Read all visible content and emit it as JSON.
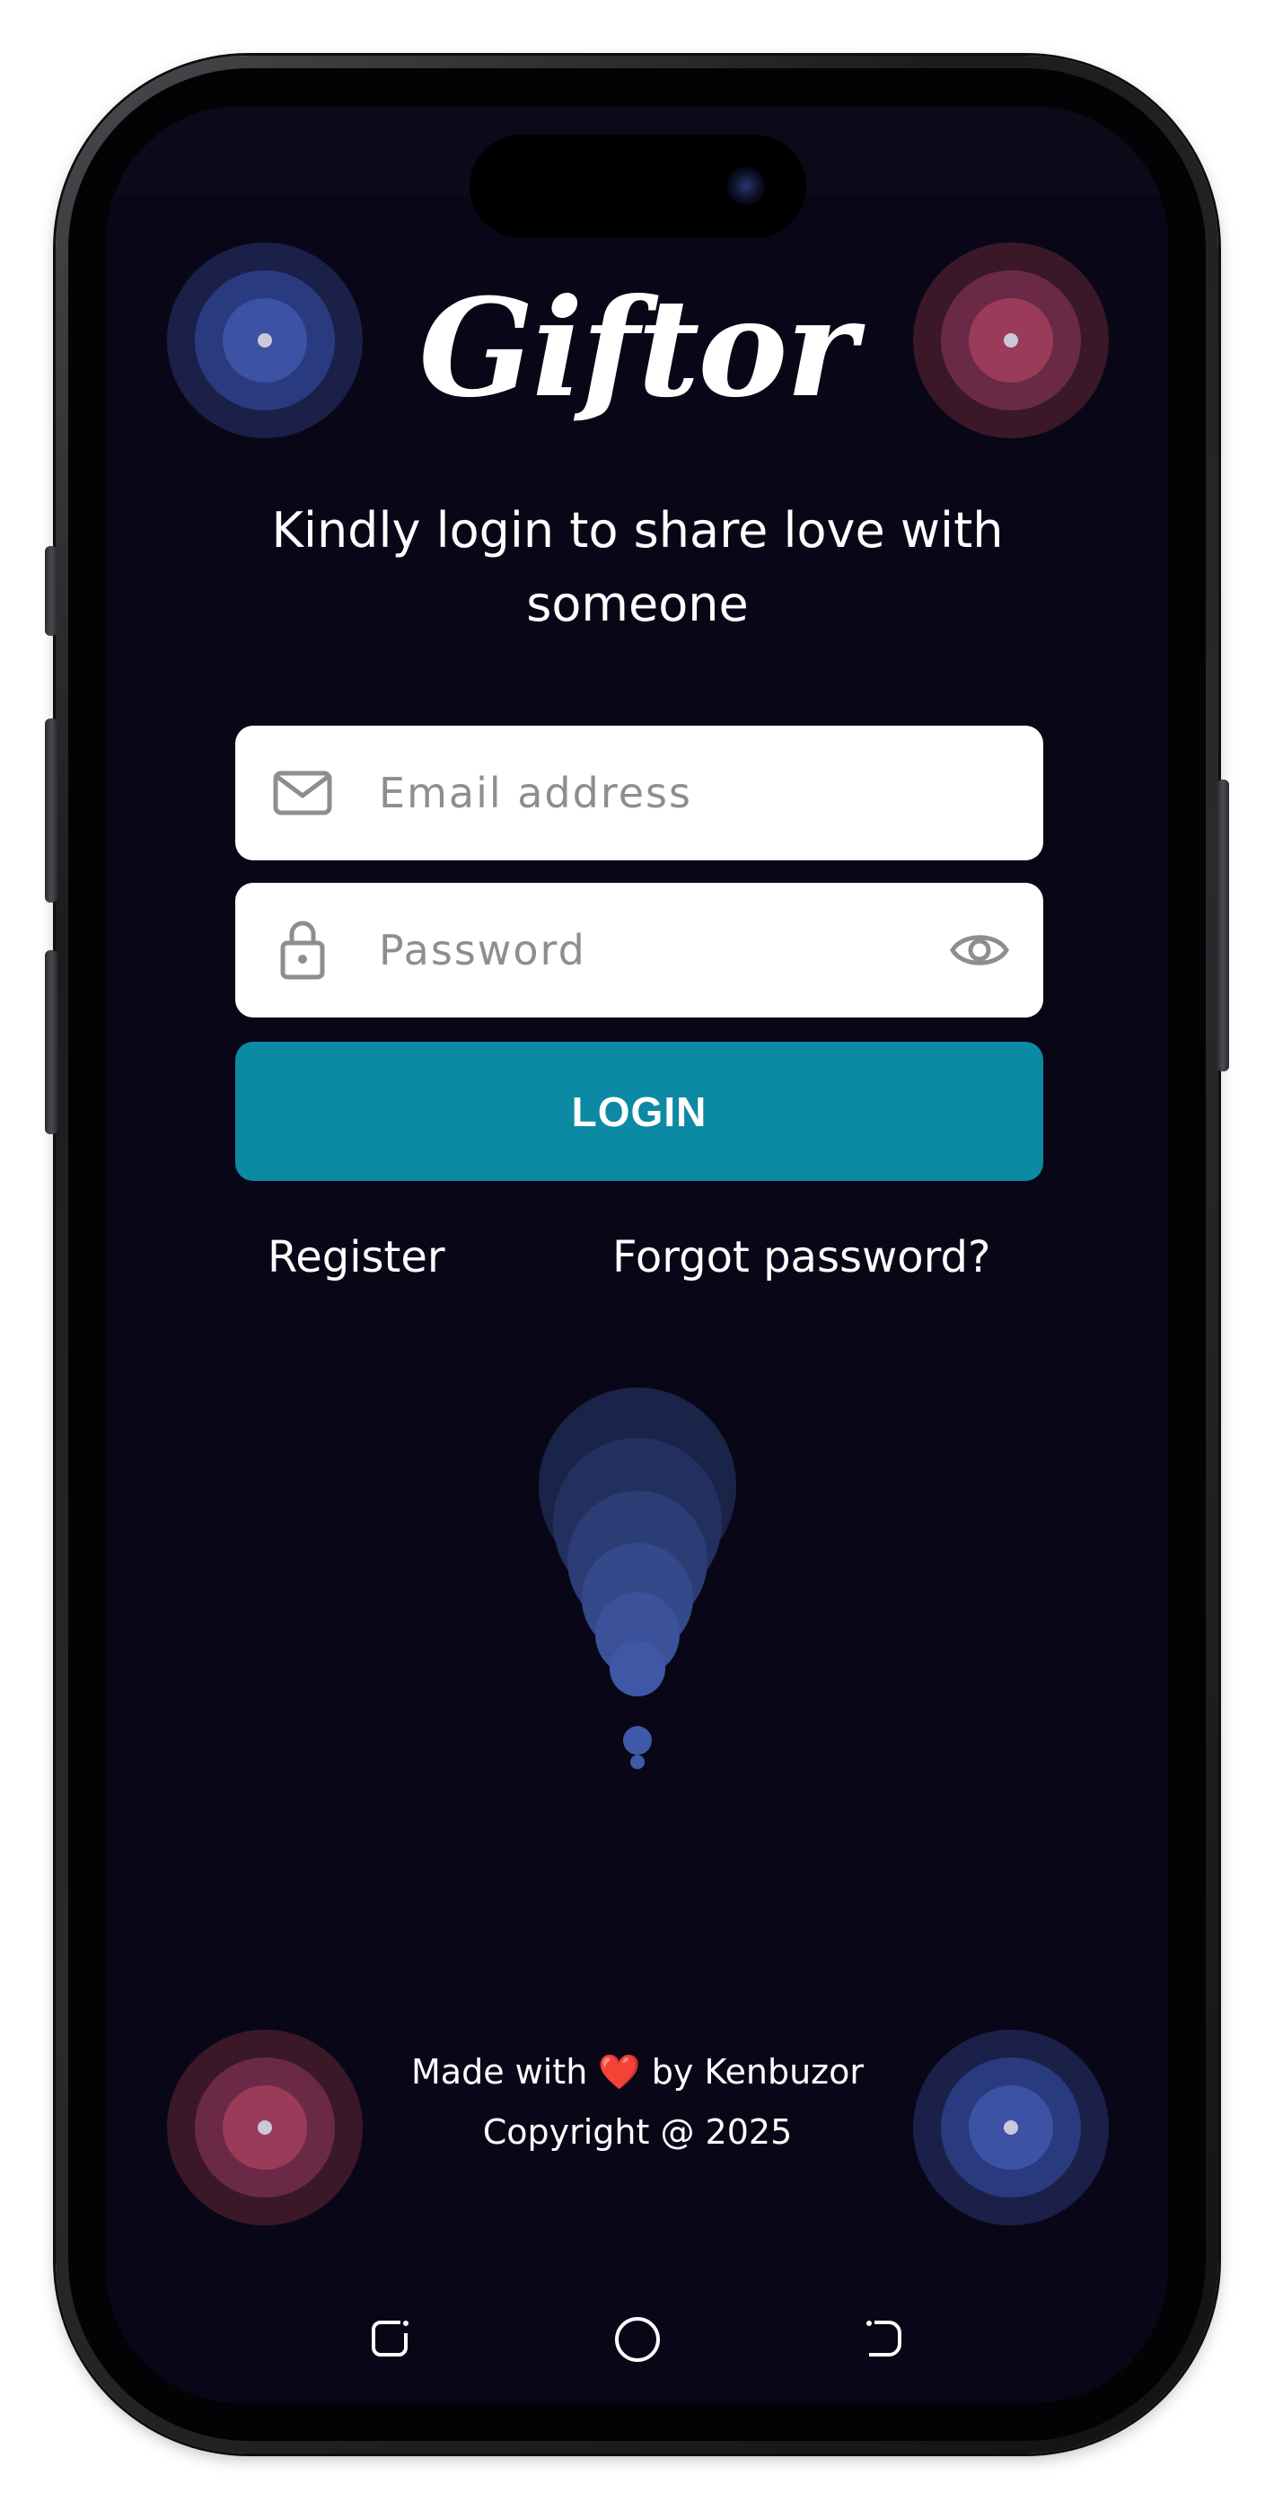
{
  "app": {
    "logo_text": "Giftor",
    "tagline": "Kindly login to share love with someone"
  },
  "form": {
    "email": {
      "placeholder": "Email address",
      "value": "",
      "icon": "envelope-icon"
    },
    "password": {
      "placeholder": "Password",
      "value": "",
      "icon": "lock-icon",
      "toggle_icon": "eye-icon"
    },
    "login_label": "LOGIN",
    "register_label": "Register",
    "forgot_label": "Forgot password?"
  },
  "footer": {
    "made_with": "Made with",
    "heart": "❤️",
    "by": "by Kenbuzor",
    "copyright": "Copyright @ 2025"
  },
  "navbar": {
    "recent_icon": "recent-apps-icon",
    "home_icon": "home-icon",
    "back_icon": "back-icon"
  },
  "colors": {
    "background": "#090717",
    "accent": "#0c89a3",
    "blue_target": "#3c52a4",
    "red_target": "#9a3b5a",
    "text": "#ffffff"
  }
}
